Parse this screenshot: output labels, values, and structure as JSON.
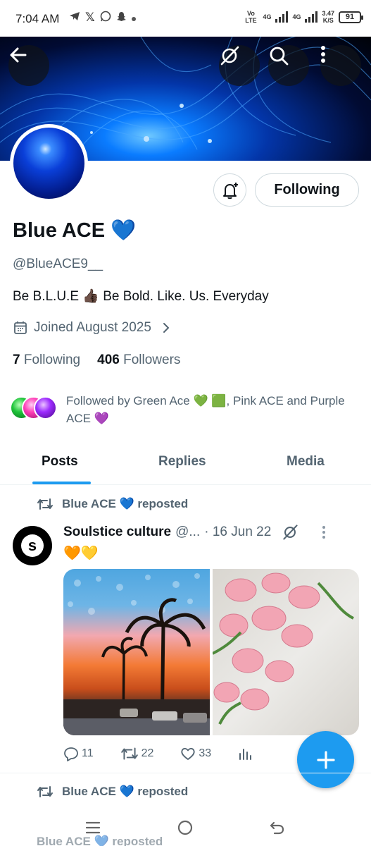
{
  "status_bar": {
    "time": "7:04 AM",
    "app_icons": [
      "telegram-icon",
      "x-icon",
      "whatsapp-icon",
      "snapchat-icon",
      "dot-icon"
    ],
    "network_1": "Vo LTE",
    "network_2": "4G",
    "network_3": "4G",
    "speed_value": "3.47",
    "speed_unit": "K/S",
    "battery": "91"
  },
  "header": {
    "back_icon": "arrow-left-icon",
    "grok_icon": "grok-icon",
    "search_icon": "search-icon",
    "more_icon": "more-vertical-icon"
  },
  "profile": {
    "display_name": "Blue ACE 💙",
    "handle": "@BlueACE9__",
    "bio": "Be B.L.U.E 👍🏿  Be Bold. Like. Us. Everyday",
    "joined": "Joined August 2025",
    "following_count": "7",
    "following_label": "Following",
    "followers_count": "406",
    "followers_label": "Followers",
    "follow_button": "Following",
    "followed_by": "Followed by Green Ace 💚 🟩, Pink ACE    and Purple ACE 💜"
  },
  "tabs": [
    {
      "label": "Posts",
      "active": true
    },
    {
      "label": "Replies",
      "active": false
    },
    {
      "label": "Media",
      "active": false
    }
  ],
  "posts": [
    {
      "repost_label": "Blue ACE 💙 reposted",
      "author_initial": "s",
      "author": "Soulstice culture",
      "handle": "@...",
      "date": "· 16 Jun 22",
      "text": "🧡💛",
      "replies": "11",
      "reposts": "22",
      "likes": "33"
    }
  ],
  "next_repost_label": "Blue ACE 💙 reposted",
  "partial_repost_label": "Blue ACE 💙 reposted",
  "colors": {
    "accent": "#1d9bf0",
    "text_primary": "#0f1419",
    "text_secondary": "#536471",
    "border": "#cfd9de"
  }
}
